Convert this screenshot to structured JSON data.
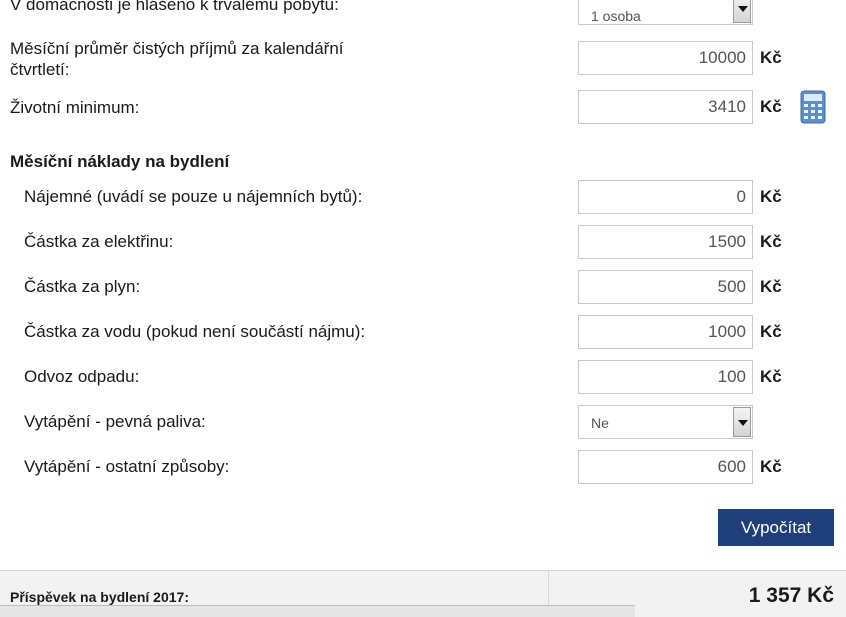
{
  "top_row": {
    "label": "V domácnosti je hlášeno k trvalému pobytu:",
    "selected": "1 osoba"
  },
  "income": {
    "label_line1": "Měsíční průměr čistých příjmů za kalendářní",
    "label_line2": "čtvrtletí:",
    "value": "10000",
    "unit": "Kč"
  },
  "minimum": {
    "label": "Životní minimum:",
    "value": "3410",
    "unit": "Kč",
    "icon": "calculator-icon"
  },
  "section": {
    "title": "Měsíční náklady na bydlení"
  },
  "costs": [
    {
      "label": "Nájemné (uvádí se pouze u nájemních bytů):",
      "value": "0",
      "unit": "Kč"
    },
    {
      "label": "Částka za elektřinu:",
      "value": "1500",
      "unit": "Kč"
    },
    {
      "label": "Částka za plyn:",
      "value": "500",
      "unit": "Kč"
    },
    {
      "label": "Částka za vodu (pokud není součástí nájmu):",
      "value": "1000",
      "unit": "Kč"
    },
    {
      "label": "Odvoz odpadu:",
      "value": "100",
      "unit": "Kč"
    }
  ],
  "heating_solid": {
    "label": "Vytápění - pevná paliva:",
    "selected": "Ne"
  },
  "heating_other": {
    "label": "Vytápění - ostatní způsoby:",
    "value": "600",
    "unit": "Kč"
  },
  "calculate_button": "Vypočítat",
  "result": {
    "label": "Příspěvek na bydlení 2017:",
    "value": "1 357 Kč"
  },
  "colors": {
    "button_bg": "#1e3f7a",
    "button_text": "#ffffff",
    "result_bg": "#f2f2f2"
  }
}
